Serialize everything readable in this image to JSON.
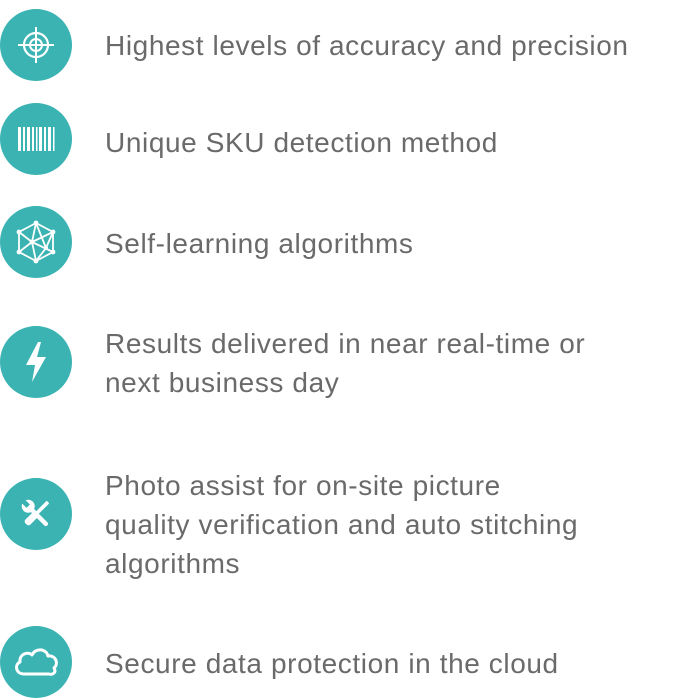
{
  "theme": {
    "icon_color": "#3bb3b3",
    "text_color": "#6a6a6a",
    "background": "#ffffff"
  },
  "features": [
    {
      "icon": "crosshair-icon",
      "lines": [
        "Highest levels of accuracy and precision"
      ]
    },
    {
      "icon": "barcode-icon",
      "lines": [
        "Unique SKU detection method"
      ]
    },
    {
      "icon": "network-polyhedron-icon",
      "lines": [
        "Self-learning algorithms"
      ]
    },
    {
      "icon": "lightning-bolt-icon",
      "lines": [
        "Results delivered in near real-time or",
        "next business day"
      ]
    },
    {
      "icon": "tools-icon",
      "lines": [
        "Photo assist for on-site picture",
        "quality verification and auto stitching",
        "algorithms"
      ]
    },
    {
      "icon": "cloud-icon",
      "lines": [
        "Secure data protection in the cloud"
      ]
    }
  ]
}
